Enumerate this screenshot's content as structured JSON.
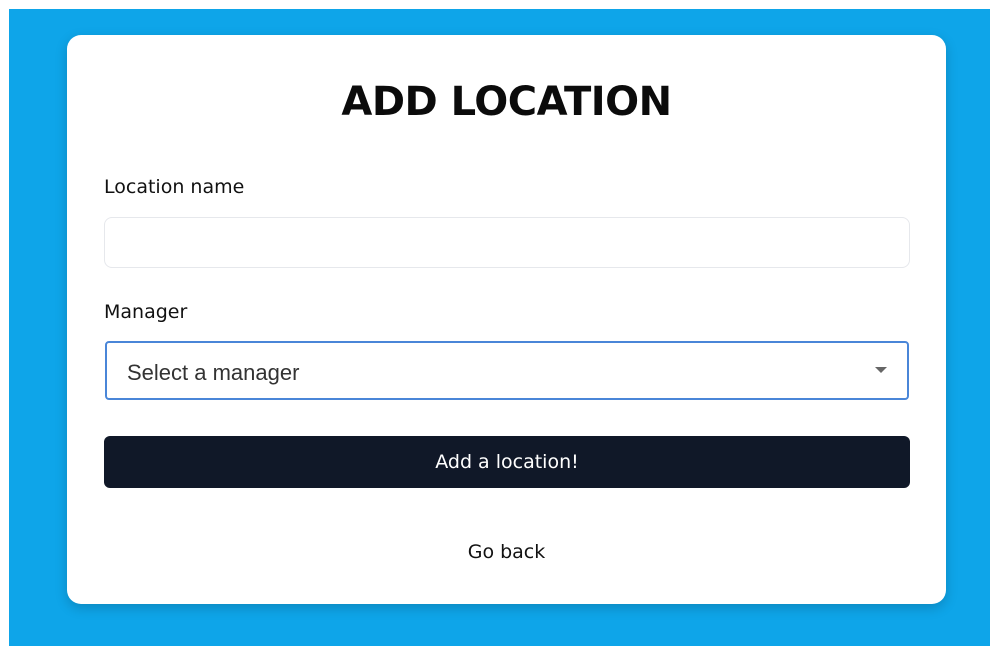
{
  "form": {
    "title": "ADD LOCATION",
    "location_name_label": "Location name",
    "location_name_value": "",
    "manager_label": "Manager",
    "manager_selected": "Select a manager",
    "submit_label": "Add a location!",
    "back_label": "Go back"
  },
  "icons": {
    "dropdown": "chevron-down-icon"
  },
  "colors": {
    "background": "#0ea5e9",
    "card": "#ffffff",
    "button": "#101828",
    "select_border": "#4a86d8"
  }
}
